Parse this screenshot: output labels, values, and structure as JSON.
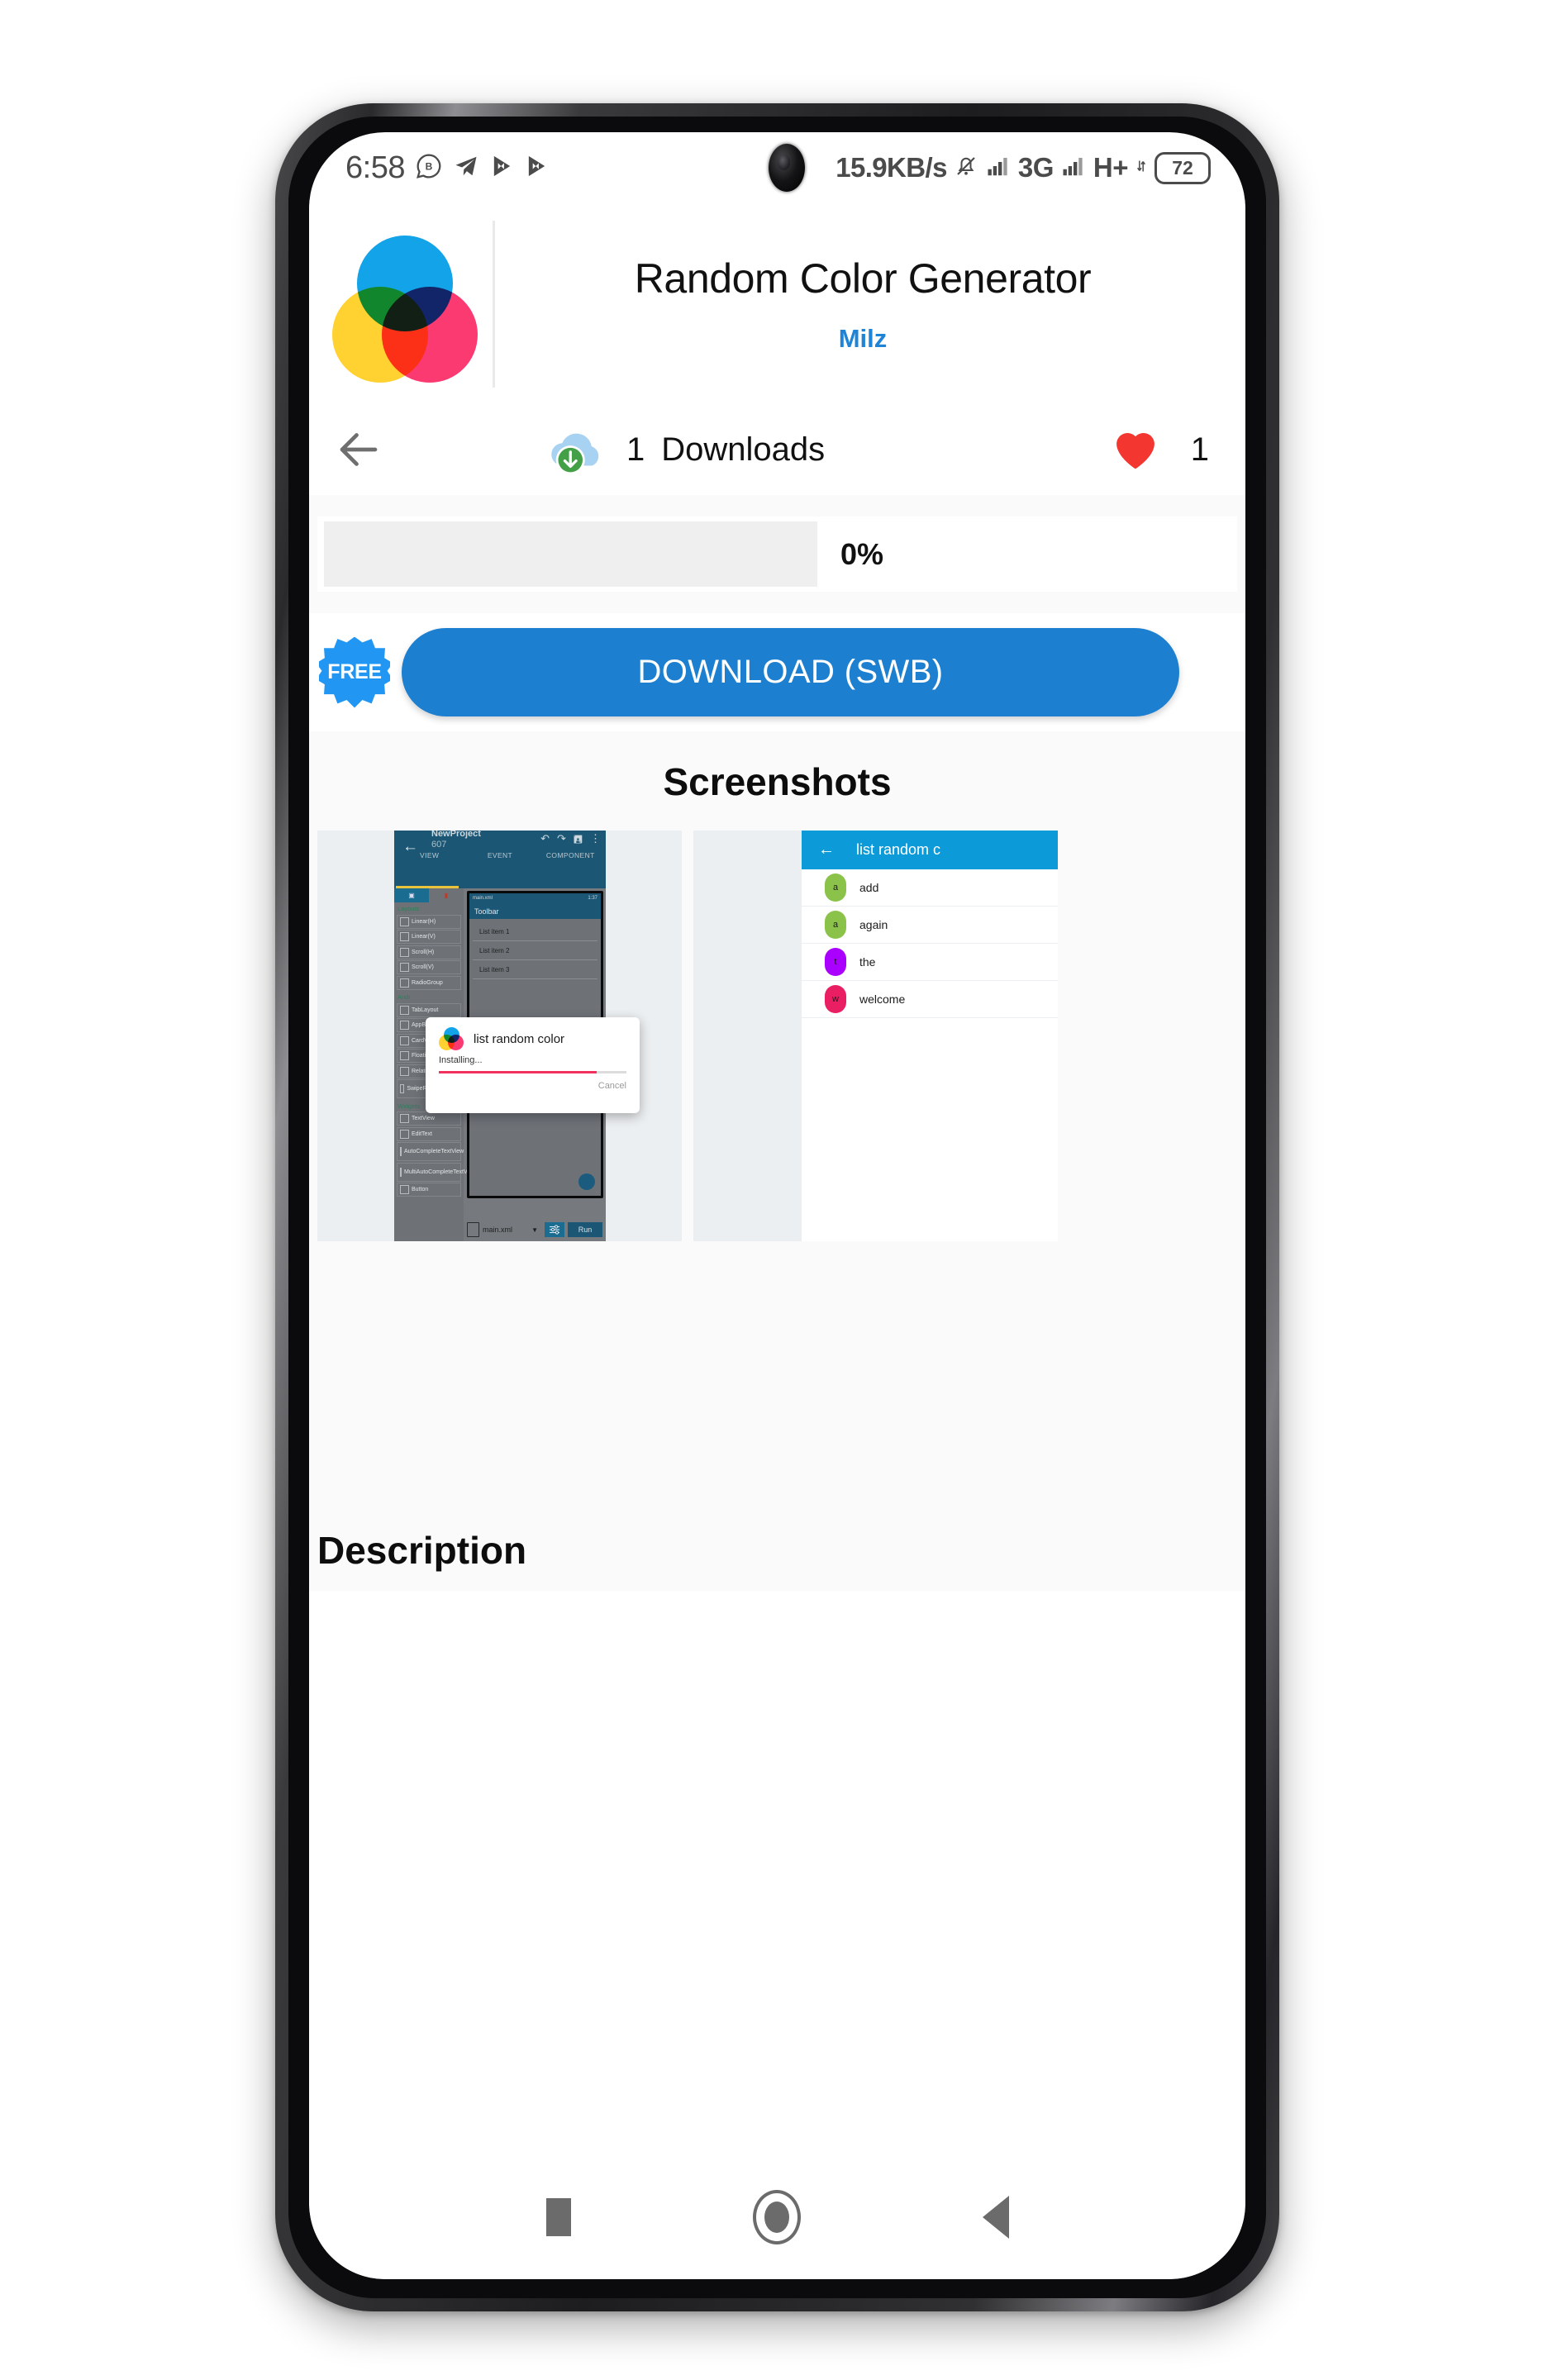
{
  "status_bar": {
    "time": "6:58",
    "left_icons": [
      "bubble-b-icon",
      "telegram-icon",
      "play-n-icon",
      "play-n-icon"
    ],
    "net_speed": "15.9KB/s",
    "mute_icon": "bell-muted-icon",
    "network_type": "3G",
    "network_mode": "H+",
    "battery_level": "72"
  },
  "app": {
    "title": "Random Color Generator",
    "developer": "Milz",
    "icon_colors": {
      "blue": "#12a3e8",
      "yellow": "#ffd131",
      "pink": "#fc3a72"
    }
  },
  "stats": {
    "back_label": "back-arrow",
    "downloads_count": "1",
    "downloads_label": "Downloads",
    "favorites_count": "1",
    "heart_color": "#f3362f",
    "cloud_color": "#a8d2f2",
    "download_badge_color": "#43a047"
  },
  "progress": {
    "percent_label": "0%",
    "value": 0,
    "track_color": "#efefef"
  },
  "download": {
    "free_badge": "FREE",
    "button_label": "DOWNLOAD (SWB)",
    "button_color": "#1d7fd0",
    "badge_color": "#2196f3"
  },
  "screenshots": {
    "heading": "Screenshots",
    "shot1": {
      "project_name": "NewProject",
      "project_number": "607",
      "toolbar_icons": [
        "undo-icon",
        "redo-icon",
        "save-icon",
        "overflow-menu-icon"
      ],
      "tabs": [
        "VIEW",
        "EVENT",
        "COMPONENT"
      ],
      "active_tab": "VIEW",
      "toolbar_color": "#1b5775",
      "palette_groups": [
        {
          "name": "Layouts",
          "items": [
            "Linear(H)",
            "Linear(V)",
            "Scroll(H)",
            "Scroll(V)",
            "RadioGroup"
          ]
        },
        {
          "name": "Andr",
          "items": [
            "TabLayout",
            "AppBarLayout",
            "CardView",
            "FloatingAction",
            "RelativeLayout",
            "SwipeRefreshLayout"
          ]
        },
        {
          "name": "Widgets",
          "items": [
            "TextView",
            "EditText",
            "AutoCompleteTextView",
            "MultiAutoCompleteTextView",
            "Button"
          ]
        }
      ],
      "preview": {
        "file_label": "main.xml",
        "clock": "1:37",
        "toolbar_title": "Toolbar",
        "list_items": [
          "List item 1",
          "List item 2",
          "List item 3"
        ]
      },
      "bottom_bar": {
        "file_name": "main.xml",
        "settings_icon": "sliders-icon",
        "run_label": "Run"
      },
      "dialog": {
        "title": "list random color",
        "status": "Installing...",
        "cancel_label": "Cancel",
        "progress_percent": 84,
        "progress_color": "#f0325c"
      }
    },
    "shot2": {
      "toolbar_title": "list random c",
      "toolbar_color": "#0d9ad8",
      "rows": [
        {
          "initial": "a",
          "label": "add",
          "color": "#8bc34a"
        },
        {
          "initial": "a",
          "label": "again",
          "color": "#8bc34a"
        },
        {
          "initial": "t",
          "label": "the",
          "color": "#aa00ff"
        },
        {
          "initial": "w",
          "label": "welcome",
          "color": "#e91e63"
        }
      ]
    }
  },
  "description": {
    "heading": "Description"
  },
  "nav_bar": {
    "items": [
      "recents-square-icon",
      "home-circle-icon",
      "back-triangle-icon"
    ]
  }
}
